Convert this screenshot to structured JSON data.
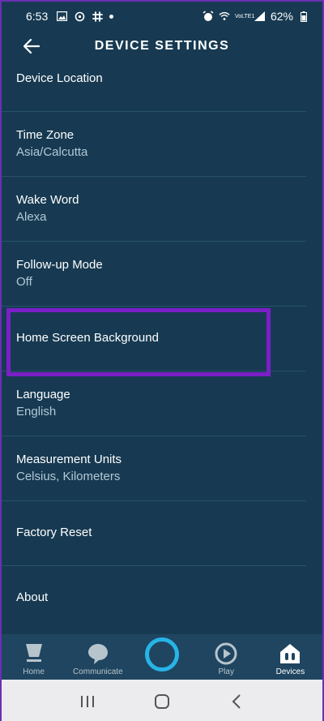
{
  "status_bar": {
    "time": "6:53",
    "battery": "62%",
    "network_label": "VoLTE1"
  },
  "header": {
    "title": "DEVICE SETTINGS"
  },
  "settings": [
    {
      "label": "Device Location",
      "value": ""
    },
    {
      "label": "Time Zone",
      "value": "Asia/Calcutta"
    },
    {
      "label": "Wake Word",
      "value": "Alexa"
    },
    {
      "label": "Follow-up Mode",
      "value": "Off"
    },
    {
      "label": "Home Screen Background",
      "value": ""
    },
    {
      "label": "Language",
      "value": "English"
    },
    {
      "label": "Measurement Units",
      "value": "Celsius, Kilometers"
    },
    {
      "label": "Factory Reset",
      "value": ""
    },
    {
      "label": "About",
      "value": ""
    }
  ],
  "bottom_nav": {
    "home": "Home",
    "communicate": "Communicate",
    "alexa": "",
    "play": "Play",
    "devices": "Devices"
  },
  "colors": {
    "background": "#173a52",
    "highlight": "#7b1fc7",
    "alexa_ring": "#27b4e6"
  }
}
